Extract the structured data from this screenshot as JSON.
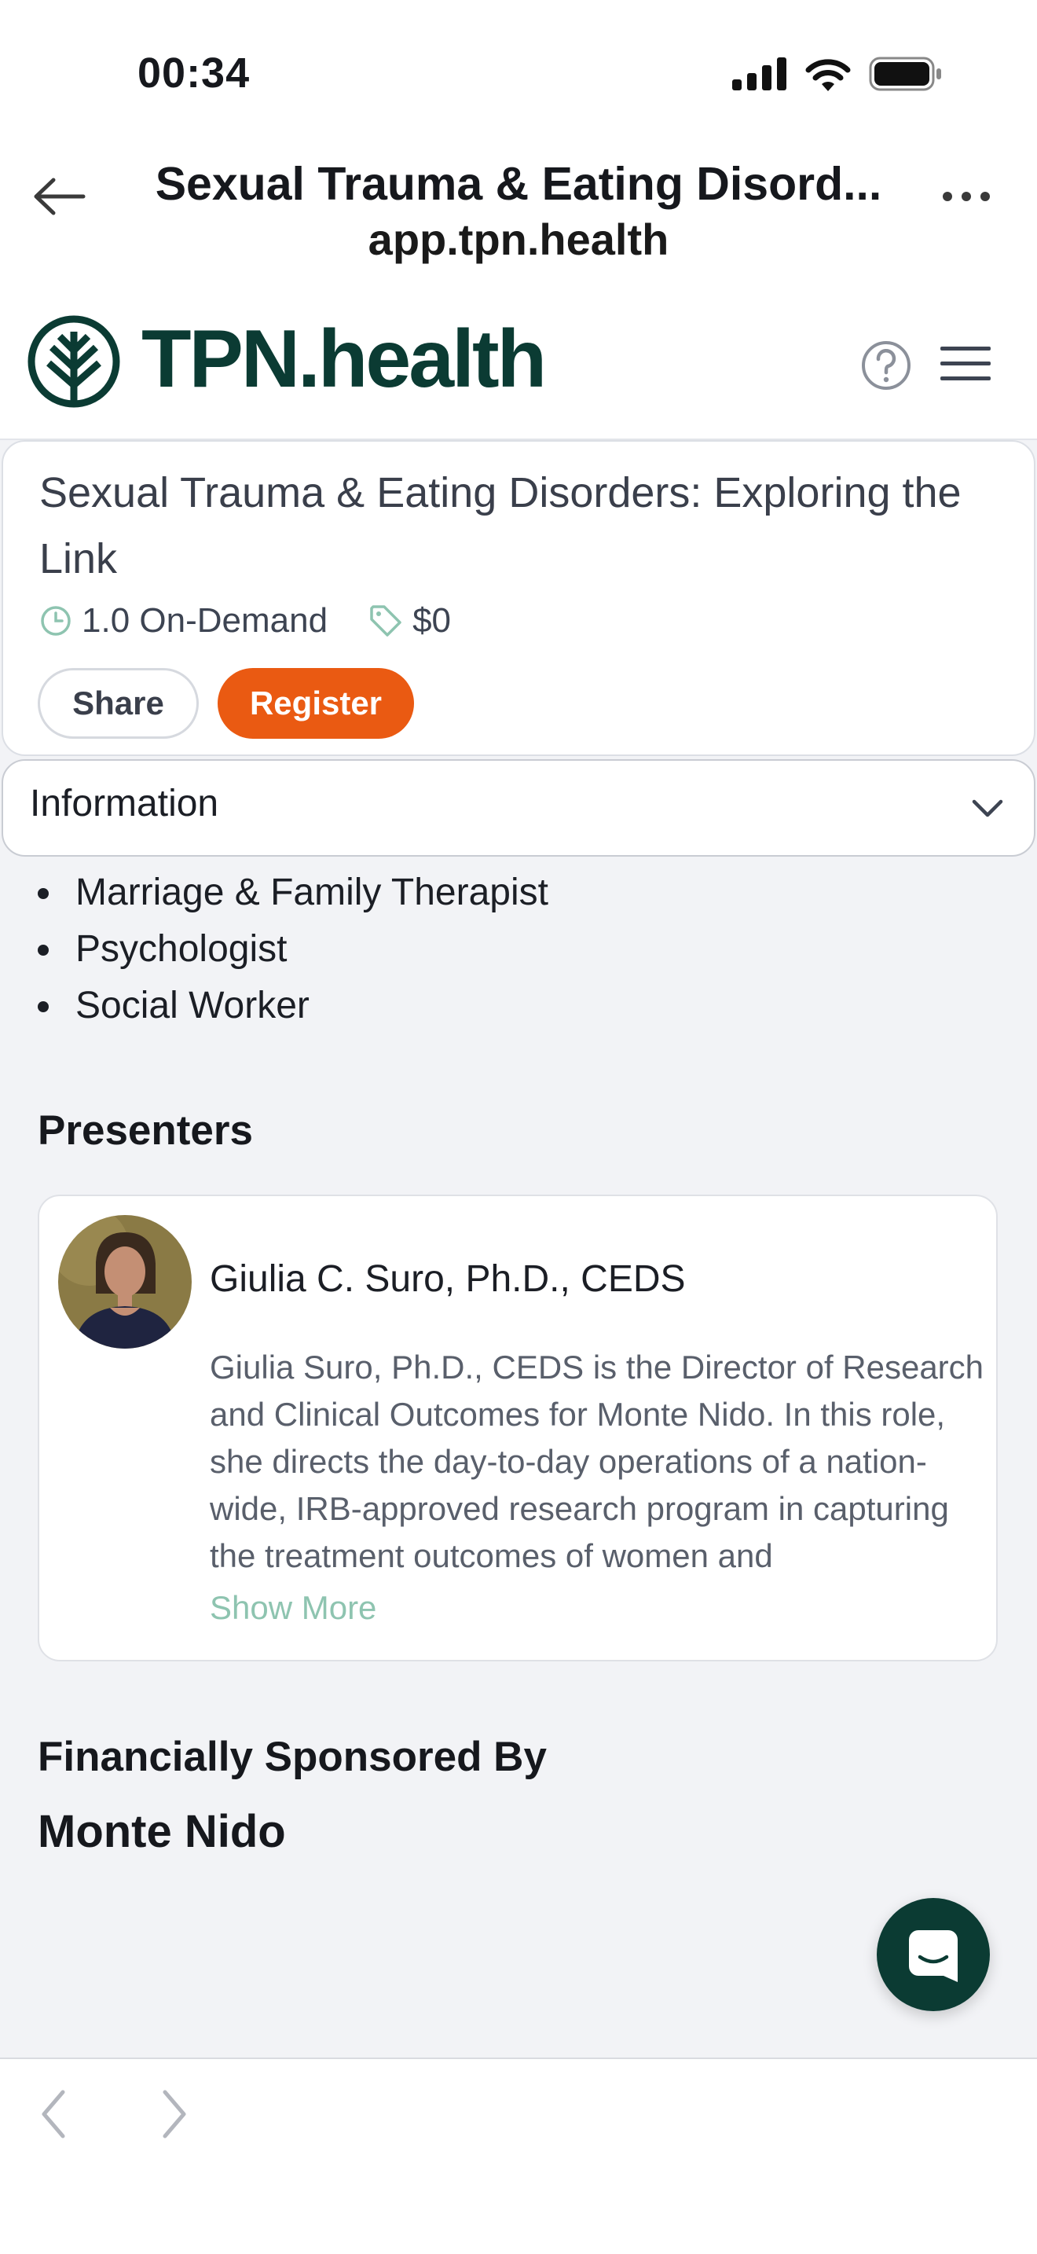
{
  "status_bar": {
    "time": "00:34"
  },
  "browser": {
    "title": "Sexual Trauma & Eating Disord...",
    "url": "app.tpn.health"
  },
  "site": {
    "logo_text": "TPN.health"
  },
  "course": {
    "title": "Sexual Trauma & Eating Disorders: Exploring the Link",
    "credits": "1.0 On-Demand",
    "price": "$0",
    "share_label": "Share",
    "register_label": "Register"
  },
  "information": {
    "label": "Information",
    "professions": [
      "Marriage & Family Therapist",
      "Psychologist",
      "Social Worker"
    ]
  },
  "presenters": {
    "heading": "Presenters",
    "items": [
      {
        "name": "Giulia C. Suro, Ph.D., CEDS",
        "bio": "Giulia Suro, Ph.D., CEDS is the Director of Research and Clinical Outcomes for Monte Nido. In this role, she directs the day-to-day operations of a nation-wide, IRB-approved research program in capturing the treatment outcomes of women and",
        "show_more": "Show More"
      }
    ]
  },
  "sponsor": {
    "heading": "Financially Sponsored By",
    "name": "Monte Nido"
  },
  "colors": {
    "brand_green": "#0b3b33",
    "accent_orange": "#ea5a12",
    "link_teal": "#8ec4b0"
  },
  "icons": [
    "back-arrow-icon",
    "more-icon",
    "help-icon",
    "menu-icon",
    "clock-icon",
    "tag-icon",
    "chevron-down-icon",
    "chat-icon",
    "chevron-left-icon",
    "chevron-right-icon"
  ]
}
